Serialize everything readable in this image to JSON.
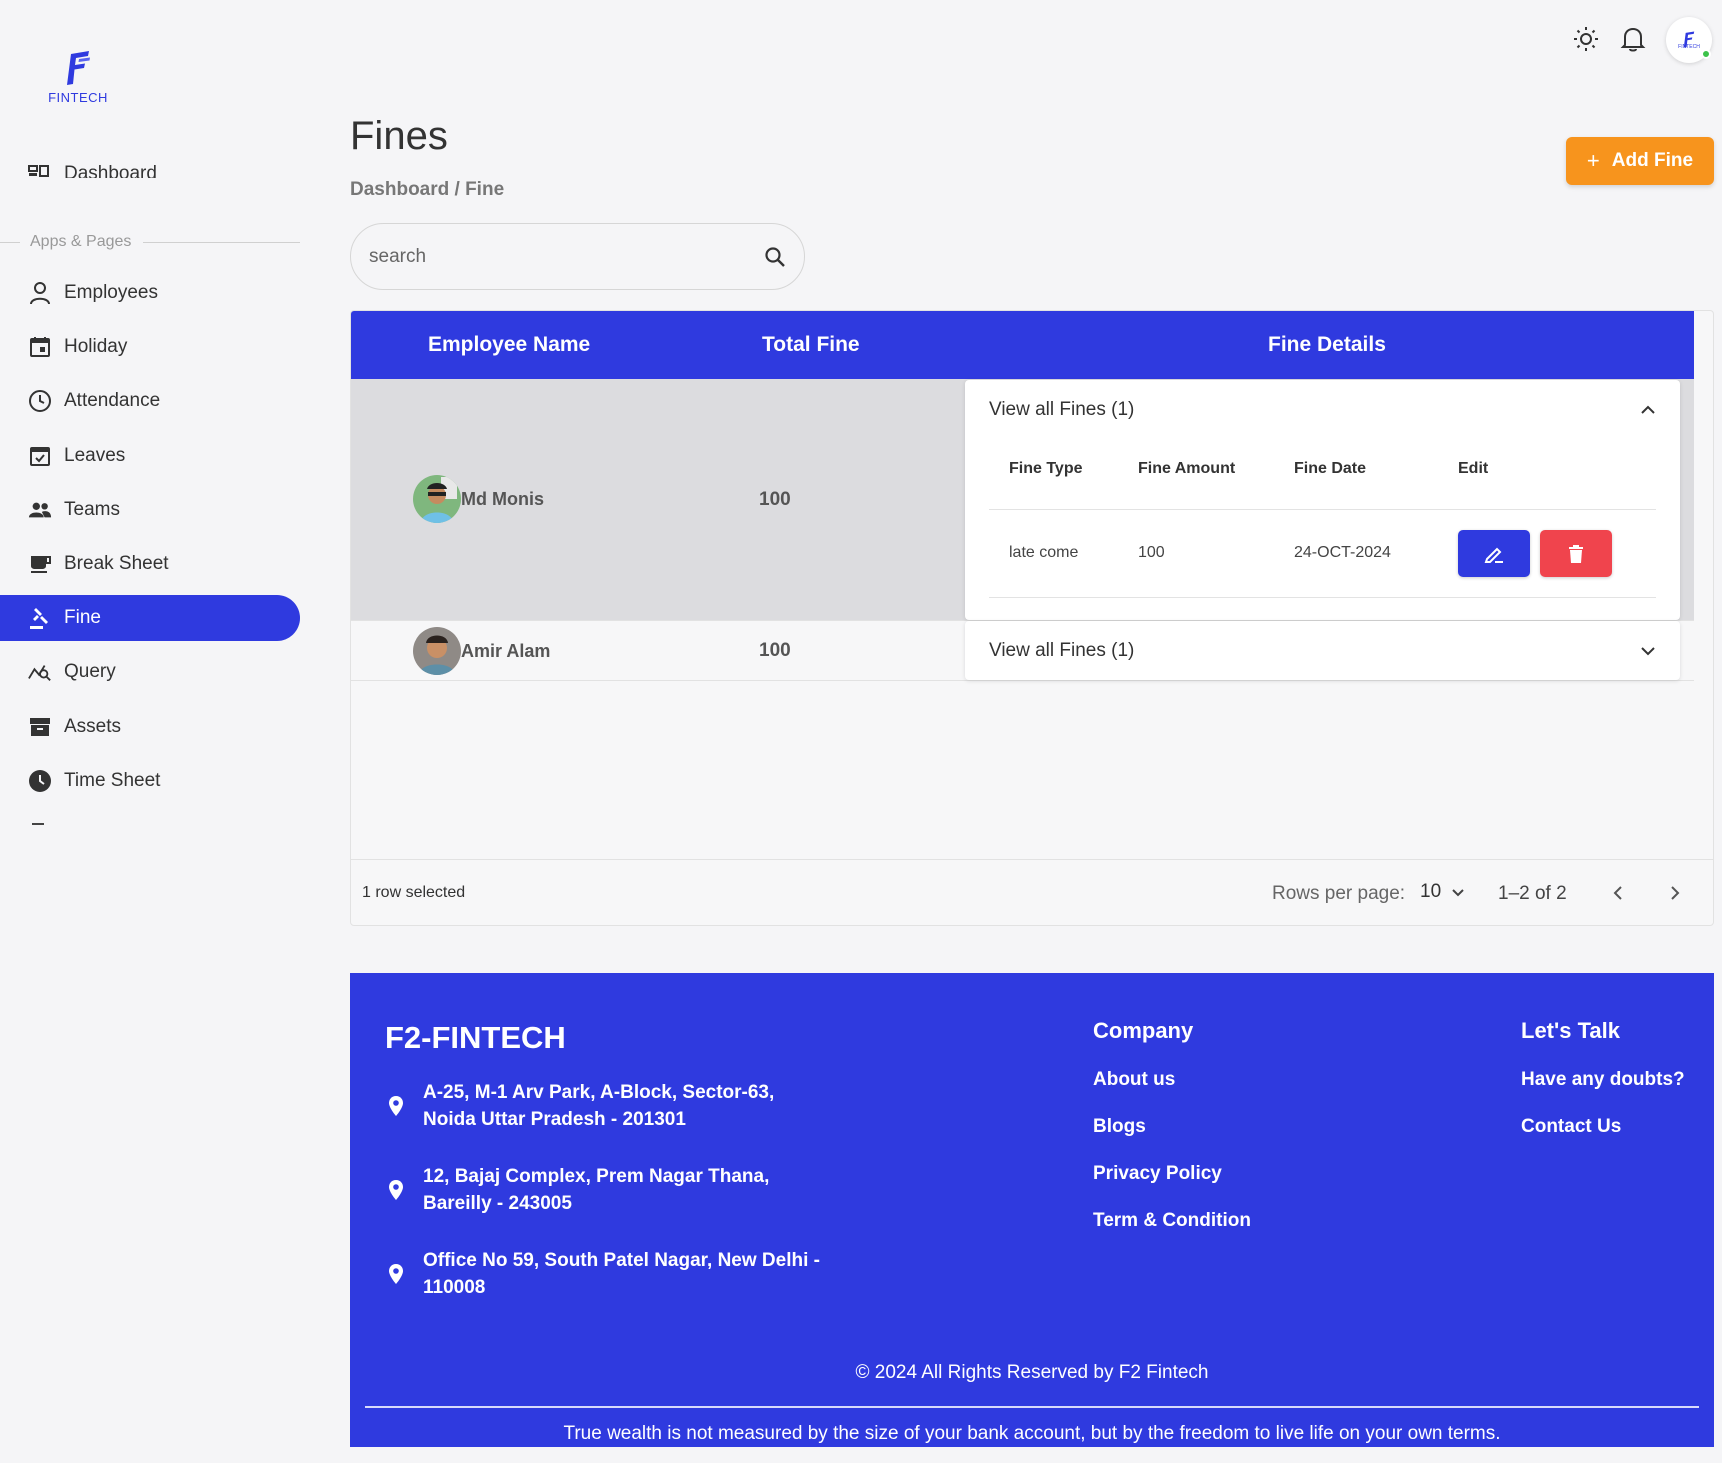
{
  "brand": {
    "logo_text": "FINTECH"
  },
  "sidebar": {
    "dashboard_label": "Dashboard",
    "section_title": "Apps & Pages",
    "items": [
      {
        "label": "Employees",
        "icon": "person-icon"
      },
      {
        "label": "Holiday",
        "icon": "calendar-icon"
      },
      {
        "label": "Attendance",
        "icon": "clock-icon"
      },
      {
        "label": "Leaves",
        "icon": "calendar-check-icon"
      },
      {
        "label": "Teams",
        "icon": "group-icon"
      },
      {
        "label": "Break Sheet",
        "icon": "coffee-icon"
      },
      {
        "label": "Fine",
        "icon": "gavel-icon",
        "active": true
      },
      {
        "label": "Query",
        "icon": "query-chart-icon"
      },
      {
        "label": "Assets",
        "icon": "archive-icon"
      },
      {
        "label": "Time Sheet",
        "icon": "clock-filled-icon"
      }
    ]
  },
  "header": {
    "title": "Fines",
    "breadcrumb": "Dashboard / Fine",
    "add_button_label": "Add Fine",
    "search_placeholder": "search",
    "avatar_text": "FINTECH"
  },
  "table": {
    "columns": [
      "Employee Name",
      "Total Fine",
      "Fine Details"
    ],
    "rows": [
      {
        "name": "Md Monis",
        "total": "100",
        "accordion_label": "View all Fines (1)",
        "expanded": true,
        "sub_columns": [
          "Fine Type",
          "Fine Amount",
          "Fine Date",
          "Edit"
        ],
        "fines": [
          {
            "type": "late come",
            "amount": "100",
            "date": "24-OCT-2024"
          }
        ]
      },
      {
        "name": "Amir Alam",
        "total": "100",
        "accordion_label": "View all Fines (1)",
        "expanded": false
      }
    ],
    "footer": {
      "selected_text": "1 row selected",
      "rows_per_page_label": "Rows per page:",
      "rows_per_page_value": "10",
      "range": "1–2 of 2"
    }
  },
  "footer": {
    "brand": "F2-FINTECH",
    "addresses": [
      {
        "line1": "A-25, M-1 Arv Park, A-Block, Sector-63,",
        "line2": "Noida Uttar Pradesh - 201301"
      },
      {
        "line1": "12, Bajaj Complex, Prem Nagar Thana,",
        "line2": "Bareilly - 243005"
      },
      {
        "line1": "Office No 59, South Patel Nagar, New Delhi -",
        "line2": "110008"
      }
    ],
    "company_title": "Company",
    "company_links": [
      "About us",
      "Blogs",
      "Privacy Policy",
      "Term & Condition"
    ],
    "talk_title": "Let's Talk",
    "talk_links": [
      "Have any doubts?",
      "Contact Us"
    ],
    "copyright": "© 2024 All Rights Reserved by F2 Fintech",
    "quote": "True wealth is not measured by the size of your bank account, but by the freedom to live life on your own terms."
  },
  "colors": {
    "primary": "#2f3adf",
    "accent_orange": "#f7941d",
    "danger": "#f0444d",
    "online": "#3cc24a"
  }
}
